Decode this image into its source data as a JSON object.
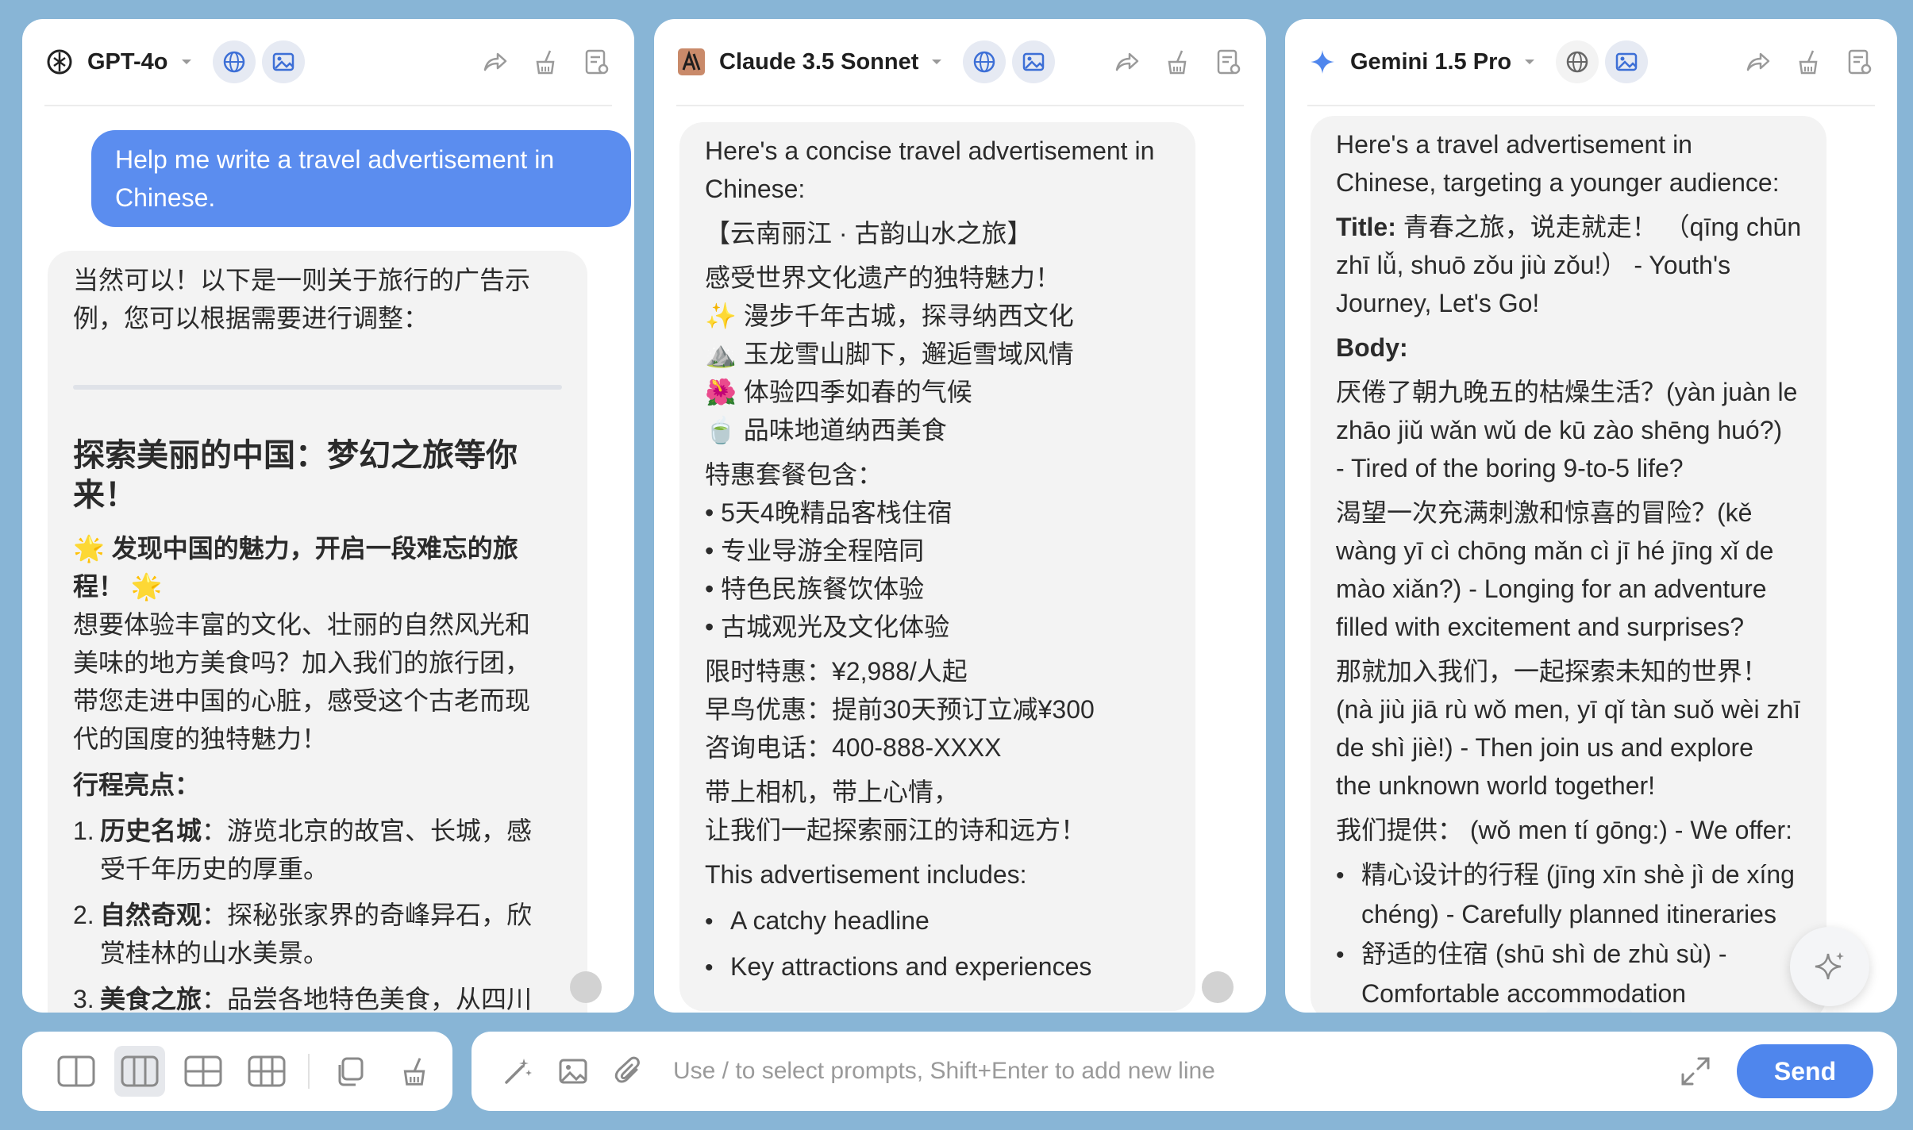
{
  "colors": {
    "accent": "#4f86ed",
    "user_bubble": "#5b8def",
    "background": "#88b5d6"
  },
  "panels": [
    {
      "model": "GPT-4o",
      "user_message": [
        "Help me write a travel advertisement in",
        "Chinese."
      ],
      "intro": [
        "当然可以！以下是一则关于旅行的广告示",
        "例，您可以根据需要进行调整："
      ],
      "heading": [
        "探索美丽的中国：梦幻之旅等你",
        "来！"
      ],
      "subheading": [
        "🌟 发现中国的魅力，开启一段难忘的旅",
        "程！ 🌟"
      ],
      "paragraph": [
        "想要体验丰富的文化、壮丽的自然风光和",
        "美味的地方美食吗？加入我们的旅行团，",
        "带您走进中国的心脏，感受这个古老而现",
        "代的国度的独特魅力！"
      ],
      "highlights_label": "行程亮点：",
      "items": [
        {
          "num": "1.",
          "title": "历史名城",
          "text": "：游览北京的故宫、长城，感",
          "cont": "受千年历史的厚重。"
        },
        {
          "num": "2.",
          "title": "自然奇观",
          "text": "：探秘张家界的奇峰异石，欣",
          "cont": "赏桂林的山水美景。"
        },
        {
          "num": "3.",
          "title": "美食之旅",
          "text": "：品尝各地特色美食，从四川",
          "cont": ""
        }
      ]
    },
    {
      "model": "Claude 3.5 Sonnet",
      "intro": [
        "Here's a concise travel advertisement in",
        "Chinese:"
      ],
      "title": "【云南丽江 · 古韵山水之旅】",
      "tagline": "感受世界文化遗产的独特魅力！",
      "features": [
        "✨ 漫步千年古城，探寻纳西文化",
        "⛰️ 玉龙雪山脚下，邂逅雪域风情",
        "🌺 体验四季如春的气候",
        "🍵 品味地道纳西美食"
      ],
      "package_label": "特惠套餐包含：",
      "package": [
        "• 5天4晚精品客栈住宿",
        "• 专业导游全程陪同",
        "• 特色民族餐饮体验",
        "• 古城观光及文化体验"
      ],
      "prices": [
        "限时特惠：¥2,988/人起",
        "早鸟优惠：提前30天预订立减¥300",
        "咨询电话：400-888-XXXX"
      ],
      "closing": [
        "带上相机，带上心情，",
        "让我们一起探索丽江的诗和远方！"
      ],
      "includes_label": "This advertisement includes:",
      "includes": [
        "A catchy headline",
        "Key attractions and experiences"
      ]
    },
    {
      "model": "Gemini 1.5 Pro",
      "intro": [
        "Here's a travel advertisement in",
        "Chinese, targeting a younger audience:"
      ],
      "title_label": "Title:",
      "title_lines": [
        " 青春之旅，说走就走！ （qīng chūn",
        "zhī lǚ, shuō zǒu jiù zǒu!） - Youth's",
        "Journey, Let's Go!"
      ],
      "body_label": "Body:",
      "p1": [
        "厌倦了朝九晚五的枯燥生活？(yàn juàn le",
        "zhāo jiǔ wǎn wǔ de kū zào shēng huó?)",
        "- Tired of the boring 9-to-5 life?"
      ],
      "p2": [
        "渴望一次充满刺激和惊喜的冒险？(kě",
        "wàng yī cì chōng mǎn cì jī hé jīng xǐ de",
        "mào xiǎn?) - Longing for an adventure",
        "filled with excitement and surprises?"
      ],
      "p3": [
        "那就加入我们，一起探索未知的世界！",
        "(nà jiù jiā rù wǒ men, yī qǐ tàn suǒ wèi zhī",
        "de shì jiè!) - Then join us and explore",
        "the unknown world together!"
      ],
      "offer": "我们提供： (wǒ men tí gōng:) - We offer:",
      "bullets": [
        [
          "精心设计的行程 (jīng xīn shè jì de xíng",
          "chéng) - Carefully planned itineraries"
        ],
        [
          "舒适的住宿 (shū shì de zhù sù) -",
          "Comfortable accommodation"
        ]
      ]
    }
  ],
  "input": {
    "placeholder": "Use / to select prompts, Shift+Enter to add new line",
    "send": "Send"
  }
}
